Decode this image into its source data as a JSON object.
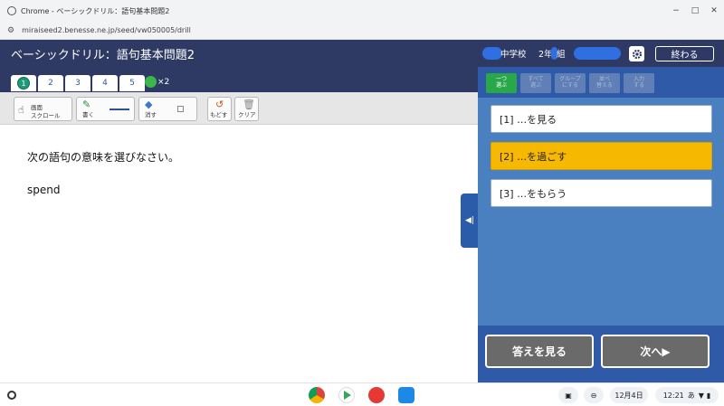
{
  "browser": {
    "window_title": "Chrome - ベーシックドリル：語句基本問題2",
    "url": "miraiseed2.benesse.ne.jp/seed/vw050005/drill"
  },
  "header": {
    "drill_title": "ベーシックドリル：語句基本問題2",
    "school": "中学校",
    "grade": "2年",
    "class_label": "組",
    "end_button": "終わる"
  },
  "tabs": [
    {
      "label": "1",
      "active": true
    },
    {
      "label": "2",
      "active": false
    },
    {
      "label": "3",
      "active": false
    },
    {
      "label": "4",
      "active": false
    },
    {
      "label": "5",
      "active": false
    }
  ],
  "multiplier": "×2",
  "tools": {
    "scroll_line1": "画面",
    "scroll_line2": "スクロール",
    "write": "書く",
    "erase": "消す",
    "undo": "もどす",
    "clear": "クリア"
  },
  "question": {
    "prompt": "次の語句の意味を選びなさい。",
    "word": "spend"
  },
  "modes": [
    {
      "line1": "一つ",
      "line2": "選ぶ",
      "active": true
    },
    {
      "line1": "すべて",
      "line2": "選ぶ",
      "active": false
    },
    {
      "line1": "グループ",
      "line2": "にする",
      "active": false
    },
    {
      "line1": "並べ",
      "line2": "替える",
      "active": false
    },
    {
      "line1": "入力",
      "line2": "する",
      "active": false
    }
  ],
  "choices": [
    {
      "label": "[1] …を見る",
      "selected": false
    },
    {
      "label": "[2] …を過ごす",
      "selected": true
    },
    {
      "label": "[3] …をもらう",
      "selected": false
    }
  ],
  "panel_buttons": {
    "show_answer": "答えを見る",
    "next": "次へ▶"
  },
  "shelf": {
    "date": "12月4日",
    "time": "12:21",
    "ime": "あ"
  },
  "colors": {
    "header_bg": "#2e3a64",
    "panel_bg": "#4a7fc0",
    "selected_choice": "#f6b800",
    "active_mode": "#29a84a"
  }
}
